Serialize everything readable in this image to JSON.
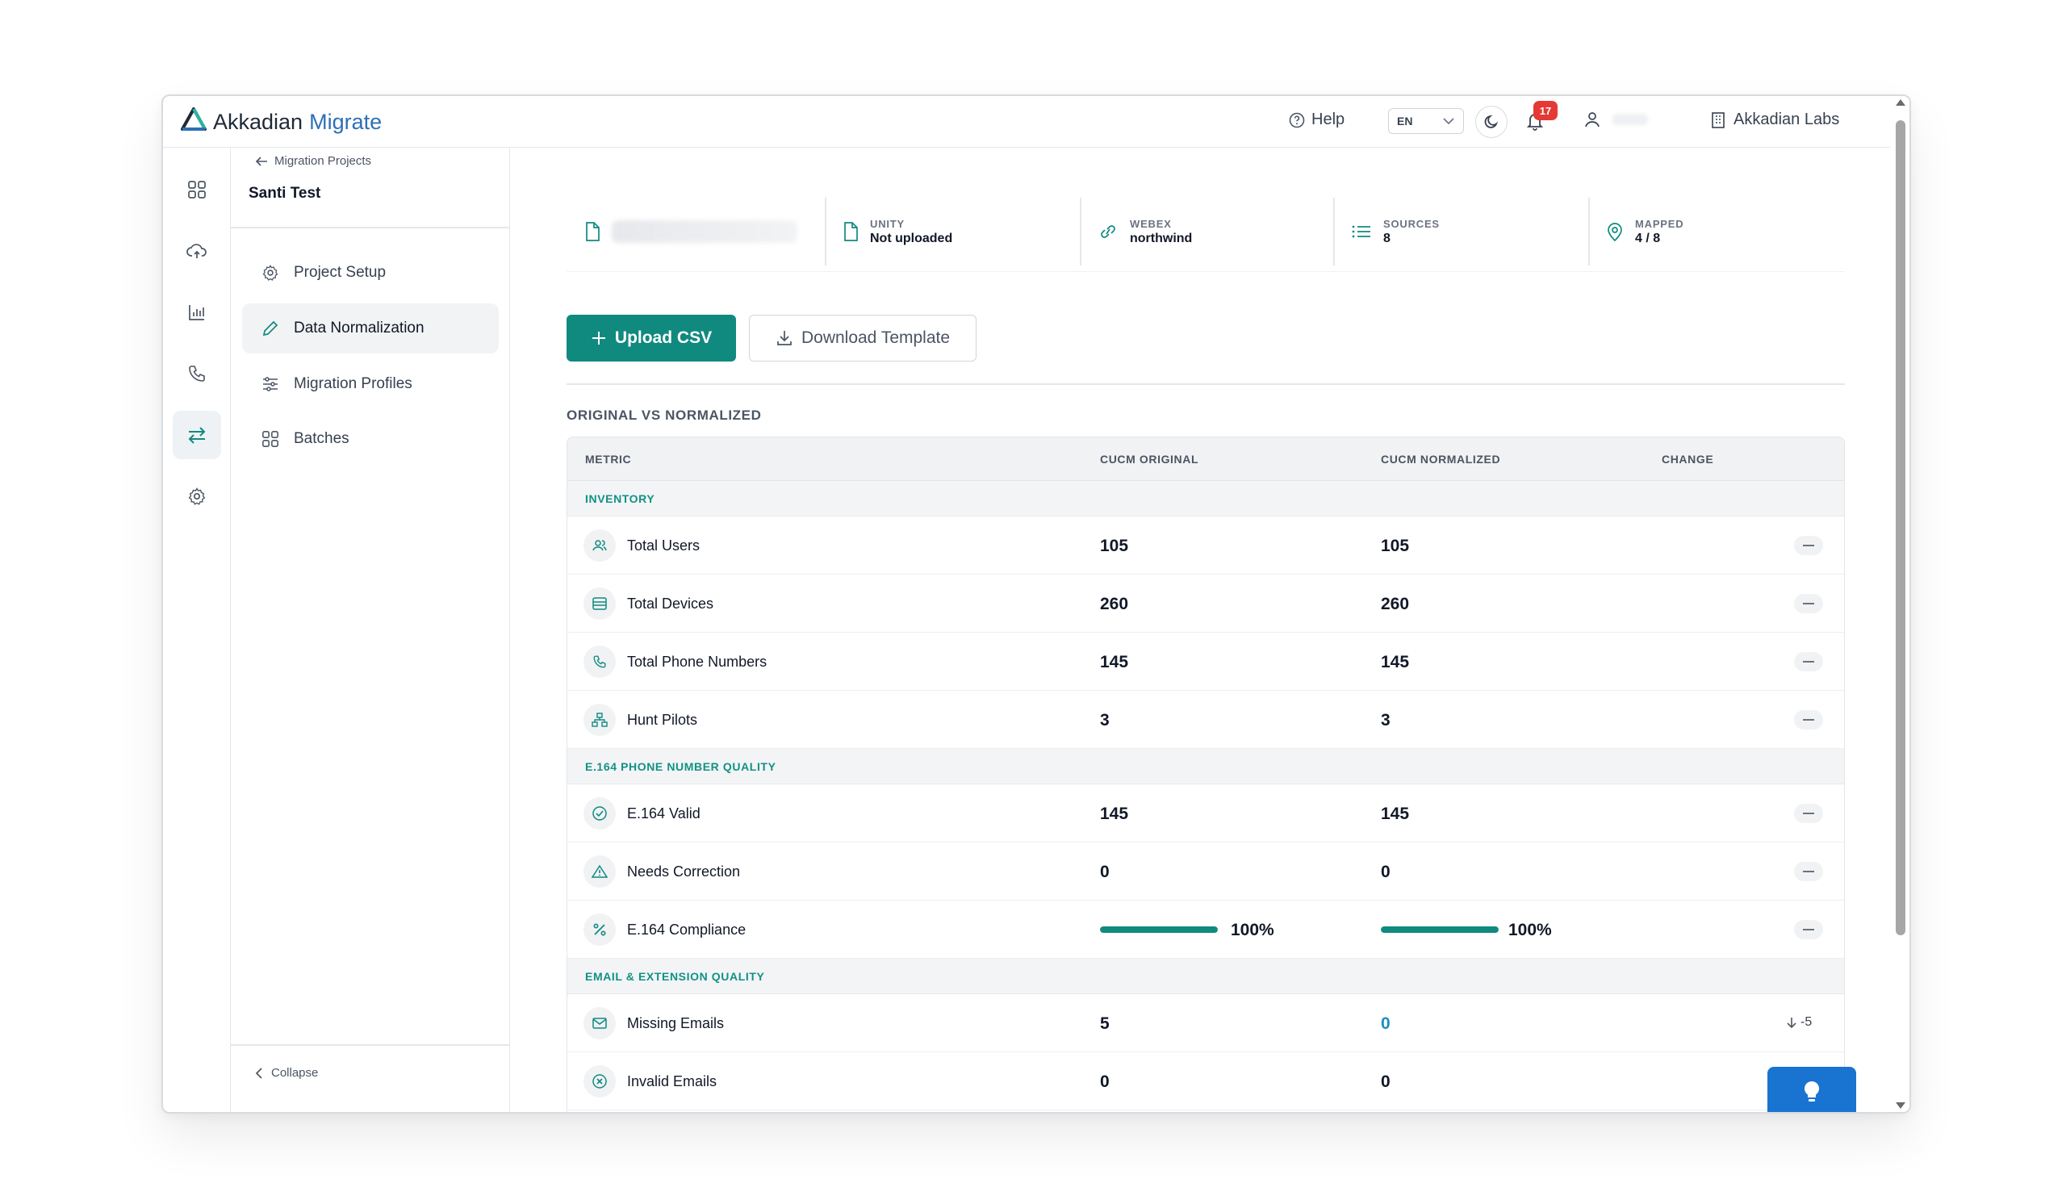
{
  "header": {
    "brand": "Akkadian",
    "product": "Migrate",
    "help_label": "Help",
    "language": "EN",
    "notification_count": "17",
    "org_name": "Akkadian Labs"
  },
  "sidenav": {
    "back_label": "Migration Projects",
    "project_name": "Santi Test",
    "items": [
      {
        "label": "Project Setup",
        "icon": "gear-icon"
      },
      {
        "label": "Data Normalization",
        "icon": "pencil-icon"
      },
      {
        "label": "Migration Profiles",
        "icon": "sliders-icon"
      },
      {
        "label": "Batches",
        "icon": "grid-icon"
      }
    ],
    "collapse_label": "Collapse"
  },
  "stats": {
    "unity": {
      "label": "UNITY",
      "value": "Not uploaded"
    },
    "webex": {
      "label": "WEBEX",
      "value": "northwind"
    },
    "sources": {
      "label": "SOURCES",
      "value": "8"
    },
    "mapped": {
      "label": "MAPPED",
      "value": "4 / 8"
    }
  },
  "actions": {
    "upload_label": "Upload CSV",
    "download_label": "Download Template"
  },
  "comparison": {
    "title": "ORIGINAL VS NORMALIZED",
    "columns": [
      "METRIC",
      "CUCM ORIGINAL",
      "CUCM NORMALIZED",
      "CHANGE"
    ],
    "groups": [
      {
        "name": "INVENTORY",
        "rows": [
          {
            "metric": "Total Users",
            "original": "105",
            "normalized": "105",
            "icon": "users-icon"
          },
          {
            "metric": "Total Devices",
            "original": "260",
            "normalized": "260",
            "icon": "device-icon"
          },
          {
            "metric": "Total Phone Numbers",
            "original": "145",
            "normalized": "145",
            "icon": "phone-icon"
          },
          {
            "metric": "Hunt Pilots",
            "original": "3",
            "normalized": "3",
            "icon": "hierarchy-icon"
          }
        ]
      },
      {
        "name": "E.164 PHONE NUMBER QUALITY",
        "rows": [
          {
            "metric": "E.164 Valid",
            "original": "145",
            "normalized": "145",
            "icon": "check-circle-icon"
          },
          {
            "metric": "Needs Correction",
            "original": "0",
            "normalized": "0",
            "icon": "warning-icon"
          },
          {
            "metric": "E.164 Compliance",
            "original": "100%",
            "normalized": "100%",
            "original_fill": 100,
            "normalized_fill": 100,
            "icon": "percent-icon"
          }
        ]
      },
      {
        "name": "EMAIL & EXTENSION QUALITY",
        "rows": [
          {
            "metric": "Missing Emails",
            "original": "5",
            "normalized": "0",
            "change": "-5",
            "icon": "mail-icon"
          },
          {
            "metric": "Invalid Emails",
            "original": "0",
            "normalized": "0",
            "icon": "x-circle-icon"
          }
        ]
      }
    ]
  },
  "colors": {
    "accent": "#108a7f",
    "link": "#2e6fb5",
    "badge": "#e53935",
    "fab": "#1874d0"
  }
}
